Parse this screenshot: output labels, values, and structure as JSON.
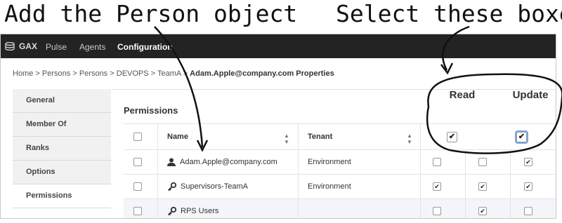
{
  "annotations": {
    "left": "Add the Person object",
    "right": "Select these boxes"
  },
  "topbar": {
    "brand": "GAX",
    "nav": [
      "Pulse",
      "Agents",
      "Configuration"
    ]
  },
  "breadcrumb": {
    "items": [
      "Home",
      "Persons",
      "Persons",
      "DEVOPS",
      "TeamA"
    ],
    "separator": ">",
    "current": "Adam.Apple@company.com Properties"
  },
  "sidebar": {
    "items": [
      "General",
      "Member Of",
      "Ranks",
      "Options",
      "Permissions"
    ],
    "active": "Permissions"
  },
  "permissions": {
    "title": "Permissions",
    "columns": {
      "name": "Name",
      "tenant": "Tenant",
      "read": "Read",
      "update": "Update"
    },
    "rows": [
      {
        "icon": "person-icon",
        "name": "Adam.Apple@company.com",
        "tenant": "Environment",
        "perm1": false,
        "perm2": false,
        "perm3": true
      },
      {
        "icon": "key-icon",
        "name": "Supervisors-TeamA",
        "tenant": "Environment",
        "perm1": true,
        "perm2": true,
        "perm3": true
      },
      {
        "icon": "key-icon",
        "name": "RPS Users",
        "tenant": "",
        "perm1": false,
        "perm2": true,
        "perm3": false
      }
    ]
  },
  "colors": {
    "topbar": "#232323",
    "highlight_ring": "#111111"
  }
}
